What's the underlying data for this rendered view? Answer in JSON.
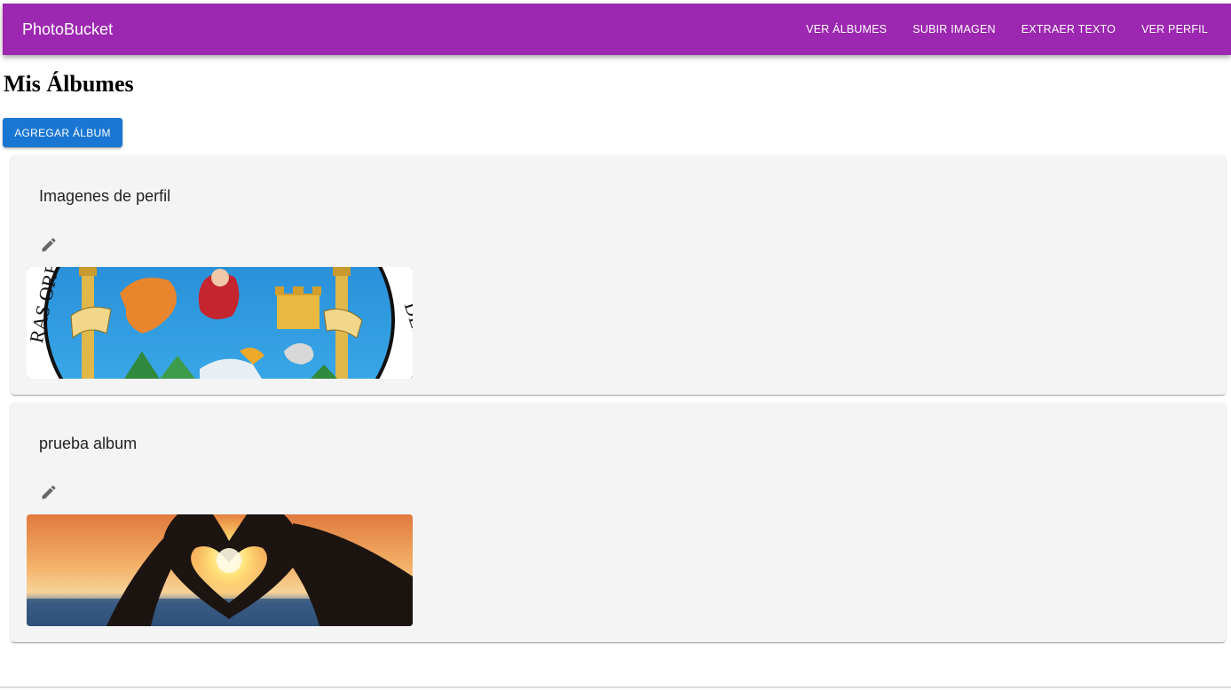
{
  "app": {
    "brand": "PhotoBucket",
    "primary_color": "#9c27b0",
    "button_color": "#1976d2"
  },
  "nav": [
    {
      "label": "VER ÁLBUMES"
    },
    {
      "label": "SUBIR IMAGEN"
    },
    {
      "label": "EXTRAER TEXTO"
    },
    {
      "label": "VER PERFIL"
    }
  ],
  "page": {
    "title": "Mis Álbumes",
    "add_button": "AGREGAR ÁLBUM"
  },
  "albums": [
    {
      "title": "Imagenes de perfil",
      "edit_icon": "pencil-icon",
      "image": "university-seal-crest"
    },
    {
      "title": "prueba album",
      "edit_icon": "pencil-icon",
      "image": "heart-hands-sunset"
    }
  ]
}
